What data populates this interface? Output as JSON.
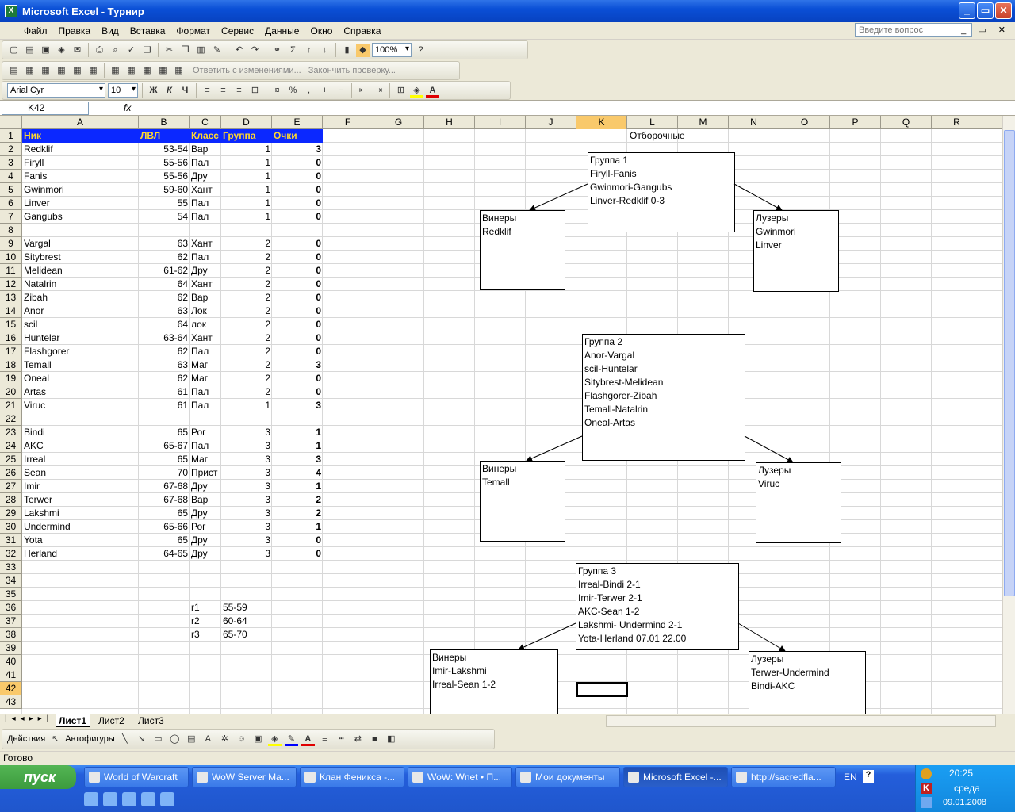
{
  "window": {
    "title": "Microsoft Excel - Турнир",
    "min": "_",
    "max": "▭",
    "close": "✕"
  },
  "menu": [
    "Файл",
    "Правка",
    "Вид",
    "Вставка",
    "Формат",
    "Сервис",
    "Данные",
    "Окно",
    "Справка"
  ],
  "help_placeholder": "Введите вопрос",
  "toolbar": {
    "zoom": "100%",
    "review_reply": "Ответить с изменениями...",
    "review_end": "Закончить проверку...",
    "font": "Arial Cyr",
    "size": "10",
    "bold": "Ж",
    "italic": "К",
    "underline": "Ч"
  },
  "formula_bar": {
    "name_box": "K42",
    "fx": "fx"
  },
  "columns": [
    "A",
    "B",
    "C",
    "D",
    "E",
    "F",
    "G",
    "H",
    "I",
    "J",
    "K",
    "L",
    "M",
    "N",
    "O",
    "P",
    "Q",
    "R"
  ],
  "rows": [
    "1",
    "2",
    "3",
    "4",
    "5",
    "6",
    "7",
    "8",
    "9",
    "10",
    "11",
    "12",
    "13",
    "14",
    "15",
    "16",
    "17",
    "18",
    "19",
    "20",
    "21",
    "22",
    "23",
    "24",
    "25",
    "26",
    "27",
    "28",
    "29",
    "30",
    "31",
    "32",
    "33",
    "34",
    "35",
    "36",
    "37",
    "38",
    "39",
    "40",
    "41",
    "42",
    "43"
  ],
  "table_header": {
    "nick": "Ник",
    "lvl": "ЛВЛ",
    "class": "Класс",
    "group": "Группа",
    "points": "Очки"
  },
  "players": [
    {
      "r": 2,
      "nick": "Redklif",
      "lvl": "53-54",
      "cls": "Вар",
      "grp": "1",
      "pts": "3"
    },
    {
      "r": 3,
      "nick": "Firyll",
      "lvl": "55-56",
      "cls": "Пал",
      "grp": "1",
      "pts": "0"
    },
    {
      "r": 4,
      "nick": "Fanis",
      "lvl": "55-56",
      "cls": "Дру",
      "grp": "1",
      "pts": "0"
    },
    {
      "r": 5,
      "nick": "Gwinmori",
      "lvl": "59-60",
      "cls": "Хант",
      "grp": "1",
      "pts": "0"
    },
    {
      "r": 6,
      "nick": "Linver",
      "lvl": "55",
      "cls": "Пал",
      "grp": "1",
      "pts": "0"
    },
    {
      "r": 7,
      "nick": "Gangubs",
      "lvl": "54",
      "cls": "Пал",
      "grp": "1",
      "pts": "0"
    },
    {
      "r": 9,
      "nick": "Vargal",
      "lvl": "63",
      "cls": "Хант",
      "grp": "2",
      "pts": "0"
    },
    {
      "r": 10,
      "nick": "Sitybrest",
      "lvl": "62",
      "cls": "Пал",
      "grp": "2",
      "pts": "0"
    },
    {
      "r": 11,
      "nick": "Melidean",
      "lvl": "61-62",
      "cls": "Дру",
      "grp": "2",
      "pts": "0"
    },
    {
      "r": 12,
      "nick": "Natalrin",
      "lvl": "64",
      "cls": "Хант",
      "grp": "2",
      "pts": "0"
    },
    {
      "r": 13,
      "nick": "Zibah",
      "lvl": "62",
      "cls": "Вар",
      "grp": "2",
      "pts": "0"
    },
    {
      "r": 14,
      "nick": "Anor",
      "lvl": "63",
      "cls": "Лок",
      "grp": "2",
      "pts": "0"
    },
    {
      "r": 15,
      "nick": "scil",
      "lvl": "64",
      "cls": "лок",
      "grp": "2",
      "pts": "0"
    },
    {
      "r": 16,
      "nick": "Huntelar",
      "lvl": "63-64",
      "cls": "Хант",
      "grp": "2",
      "pts": "0"
    },
    {
      "r": 17,
      "nick": "Flashgorer",
      "lvl": "62",
      "cls": "Пал",
      "grp": "2",
      "pts": "0"
    },
    {
      "r": 18,
      "nick": "Temall",
      "lvl": "63",
      "cls": "Маг",
      "grp": "2",
      "pts": "3"
    },
    {
      "r": 19,
      "nick": "Oneal",
      "lvl": "62",
      "cls": "Маг",
      "grp": "2",
      "pts": "0"
    },
    {
      "r": 20,
      "nick": "Artas",
      "lvl": "61",
      "cls": "Пал",
      "grp": "2",
      "pts": "0"
    },
    {
      "r": 21,
      "nick": "Viruc",
      "lvl": "61",
      "cls": "Пал",
      "grp": "1",
      "pts": "3"
    },
    {
      "r": 23,
      "nick": "Bindi",
      "lvl": "65",
      "cls": "Рог",
      "grp": "3",
      "pts": "1"
    },
    {
      "r": 24,
      "nick": "AKC",
      "lvl": "65-67",
      "cls": "Пал",
      "grp": "3",
      "pts": "1"
    },
    {
      "r": 25,
      "nick": "Irreal",
      "lvl": "65",
      "cls": "Маг",
      "grp": "3",
      "pts": "3"
    },
    {
      "r": 26,
      "nick": "Sean",
      "lvl": "70",
      "cls": "Прист",
      "grp": "3",
      "pts": "4"
    },
    {
      "r": 27,
      "nick": "Imir",
      "lvl": "67-68",
      "cls": "Дру",
      "grp": "3",
      "pts": "1"
    },
    {
      "r": 28,
      "nick": "Terwer",
      "lvl": "67-68",
      "cls": "Вар",
      "grp": "3",
      "pts": "2"
    },
    {
      "r": 29,
      "nick": "Lakshmi",
      "lvl": "65",
      "cls": "Дру",
      "grp": "3",
      "pts": "2"
    },
    {
      "r": 30,
      "nick": "Undermind",
      "lvl": "65-66",
      "cls": "Рог",
      "grp": "3",
      "pts": "1"
    },
    {
      "r": 31,
      "nick": "Yota",
      "lvl": "65",
      "cls": "Дру",
      "grp": "3",
      "pts": "0"
    },
    {
      "r": 32,
      "nick": "Herland",
      "lvl": "64-65",
      "cls": "Дру",
      "grp": "3",
      "pts": "0"
    }
  ],
  "ranges": [
    {
      "r": 36,
      "k": "r1",
      "v": "55-59"
    },
    {
      "r": 37,
      "k": "r2",
      "v": "60-64"
    },
    {
      "r": 38,
      "k": "r3",
      "v": "65-70"
    }
  ],
  "qual_title": "Отборочные",
  "groups": [
    {
      "lines": [
        "Группа 1",
        "Firyll-Fanis",
        "Gwinmori-Gangubs",
        "Linver-Redklif        0-3"
      ]
    },
    {
      "lines": [
        "Группа 2",
        "Anor-Vargal",
        "scil-Huntelar",
        "Sitybrest-Melidean",
        "Flashgorer-Zibah",
        "Temall-Natalrin",
        "Oneal-Artas"
      ]
    },
    {
      "lines": [
        "Группа 3",
        "Irreal-Bindi                 2-1",
        "Imir-Terwer                 2-1",
        "AKC-Sean                   1-2",
        "Lakshmi- Undermind  2-1",
        "Yota-Herland             07.01 22.00"
      ]
    }
  ],
  "winners": [
    [
      "Винеры",
      "Redklif"
    ],
    [
      "Винеры",
      "Temall"
    ],
    [
      "Винеры",
      "Imir-Lakshmi",
      "Irreal-Sean 1-2"
    ]
  ],
  "losers": [
    [
      "Лузеры",
      "Gwinmori",
      "Linver"
    ],
    [
      "Лузеры",
      "Viruc"
    ],
    [
      "Лузеры",
      "Terwer-Undermind",
      "Bindi-AKC"
    ]
  ],
  "sheets": [
    "Лист1",
    "Лист2",
    "Лист3"
  ],
  "draw": {
    "actions": "Действия",
    "autoshapes": "Автофигуры"
  },
  "status": "Готово",
  "taskbar": {
    "start": "пуск",
    "tasks": [
      "World of Warcraft",
      "WoW Server Ma...",
      "Клан Феникса -...",
      "WoW: Wnet • П...",
      "Мои документы",
      "Microsoft Excel -...",
      "http://sacredfla..."
    ],
    "lang": "EN",
    "time": "20:25",
    "day": "среда",
    "date": "09.01.2008"
  }
}
